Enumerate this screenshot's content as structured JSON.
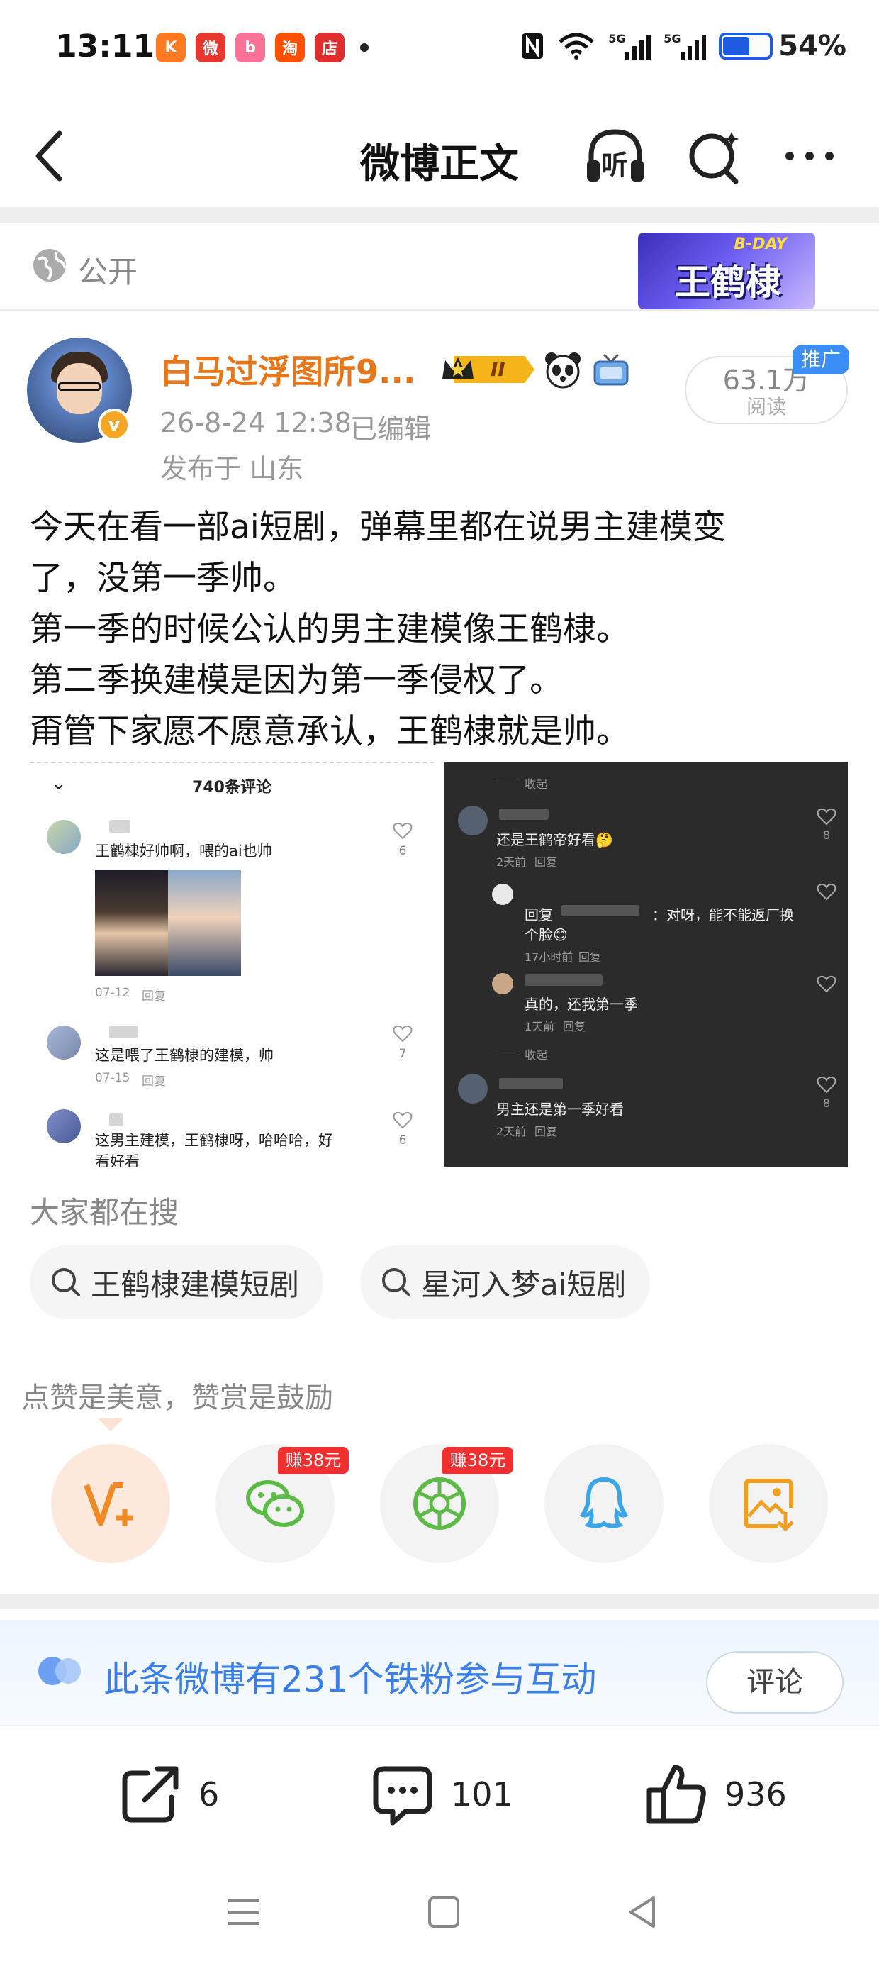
{
  "status_bar": {
    "time": "13:11",
    "apps": [
      {
        "name": "kuaishou-icon",
        "glyph": "K",
        "color": "#ff7a20"
      },
      {
        "name": "weibo-icon",
        "glyph": "微",
        "color": "#e6382f"
      },
      {
        "name": "bilibili-icon",
        "glyph": "b",
        "color": "#fb7299"
      },
      {
        "name": "taobao-icon",
        "glyph": "淘",
        "color": "#ff5000"
      },
      {
        "name": "shop-icon",
        "glyph": "店",
        "color": "#e02e2e"
      }
    ],
    "network_1": "5G",
    "network_2": "5G",
    "battery": "54%"
  },
  "header": {
    "title": "微博正文",
    "listen_label": "听"
  },
  "visibility": {
    "label": "公开"
  },
  "banner": {
    "tag": "B-DAY",
    "name": "王鹤棣"
  },
  "author": {
    "name": "白马过浮图所9...",
    "level": "II",
    "time": "26-8-24 12:38",
    "edited": "已编辑",
    "location": "发布于 山东",
    "verified_glyph": "v",
    "reads_count": "63.1万",
    "reads_label": "阅读",
    "promo_tag": "推广"
  },
  "post": {
    "lines": [
      "今天在看一部ai短剧，弹幕里都在说男主建模变",
      "了，没第一季帅。",
      "第一季的时候公认的男主建模像王鹤棣。",
      "第二季换建模是因为第一季侵权了。",
      "甭管下家愿不愿意承认，王鹤棣就是帅。"
    ]
  },
  "image_left": {
    "header": "740条评论",
    "close_glyph": "⌄",
    "comments": [
      {
        "text": "王鹤棣好帅啊，喂的ai也帅",
        "date": "07-12",
        "reply": "回复",
        "likes": "6"
      },
      {
        "text": "这是喂了王鹤棣的建模，帅",
        "date": "07-15",
        "reply": "回复",
        "likes": "7"
      },
      {
        "text": "这男主建模，王鹤棣呀，哈哈哈，好",
        "more": "看好看",
        "likes": "6"
      }
    ]
  },
  "image_right": {
    "collapse_1": "收起",
    "collapse_2": "收起",
    "comments": [
      {
        "text": "还是王鹤帝好看🤔",
        "meta": "2天前",
        "reply": "回复",
        "likes": "8"
      },
      {
        "text_prefix": "回复",
        "text_suffix": "：对呀，能不能返厂换",
        "text_line2": "个脸😊",
        "meta": "17小时前",
        "reply": "回复"
      },
      {
        "text": "真的，还我第一季",
        "meta": "1天前",
        "reply": "回复"
      },
      {
        "text": "男主还是第一季好看",
        "meta": "2天前",
        "reply": "回复",
        "likes": "8"
      }
    ]
  },
  "searching": {
    "title": "大家都在搜",
    "chips": [
      "王鹤棣建模短剧",
      "星河入梦ai短剧"
    ]
  },
  "reward": {
    "text": "点赞是美意，赞赏是鼓励",
    "earn_tag_1": "赚38元",
    "earn_tag_2": "赚38元"
  },
  "fans": {
    "text": "此条微博有231个铁粉参与互动",
    "comment_button": "评论"
  },
  "actions": {
    "reposts": "6",
    "comments": "101",
    "likes": "936"
  },
  "colors": {
    "accent_orange": "#e8761a",
    "link_blue": "#3a7ee8",
    "earn_red": "#f03030"
  }
}
